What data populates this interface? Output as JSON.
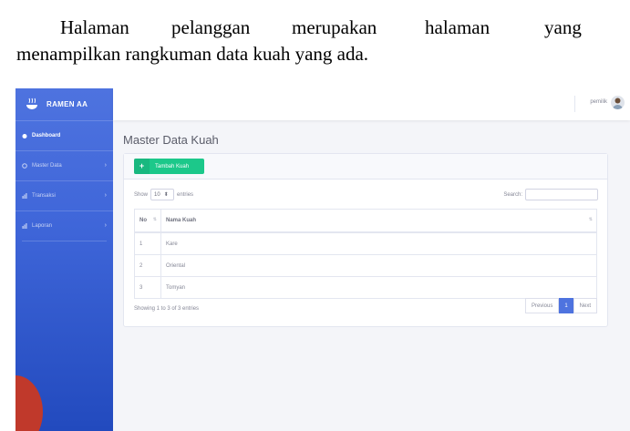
{
  "doc": {
    "line1_words": [
      "Halaman",
      "pelanggan",
      "merupakan",
      "halaman",
      "yang"
    ],
    "line2": "menampilkan rangkuman data kuah yang ada."
  },
  "app": {
    "brand": "RAMEN AA",
    "user": "pemilik",
    "nav": [
      {
        "label": "Dashboard",
        "active": true
      },
      {
        "label": "Master Data",
        "active": false
      },
      {
        "label": "Transaksi",
        "active": false
      },
      {
        "label": "Laporan",
        "active": false
      }
    ],
    "page_title": "Master Data Kuah",
    "add_button": "Tambah Kuah",
    "show_label": "Show",
    "show_value": "10",
    "entries_label": "entries",
    "search_label": "Search:",
    "search_value": "",
    "columns": [
      "No",
      "Nama Kuah"
    ],
    "rows": [
      [
        "1",
        "Kare"
      ],
      [
        "2",
        "Oriental"
      ],
      [
        "3",
        "Tomyan"
      ]
    ],
    "info": "Showing 1 to 3 of 3 entries",
    "pager": {
      "prev": "Previous",
      "current": "1",
      "next": "Next"
    }
  },
  "colors": {
    "sidebar": "#4e73df",
    "success": "#1cc88a",
    "primary": "#4e73df"
  }
}
